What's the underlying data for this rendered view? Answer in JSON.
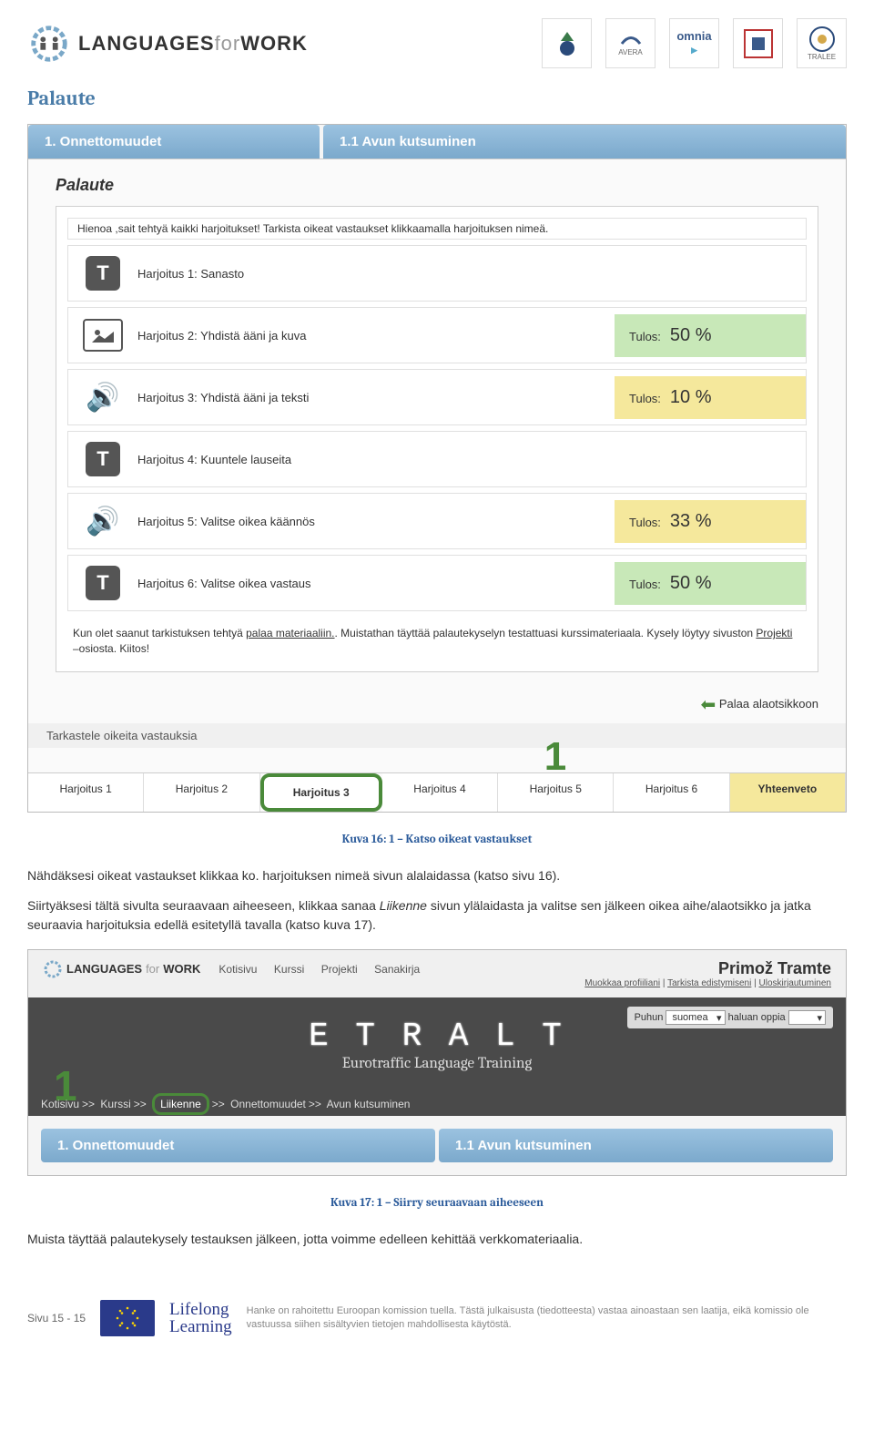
{
  "logo": {
    "text1": "LANGUAGES",
    "text2": "for",
    "text3": "WORK"
  },
  "partners": [
    "",
    "AVERA",
    "omnia",
    "",
    "TRALEE"
  ],
  "section_title": "Palaute",
  "tabs": {
    "tab1": "1. Onnettomuudet",
    "tab2": "1.1 Avun kutsuminen"
  },
  "palute_heading": "Palaute",
  "intro": "Hienoa ,sait tehtyä kaikki harjoitukset! Tarkista oikeat vastaukset klikkaamalla harjoituksen nimeä.",
  "exercises": [
    {
      "label": "Harjoitus 1: Sanasto",
      "tulos": "",
      "pct": "",
      "bg": ""
    },
    {
      "label": "Harjoitus 2: Yhdistä ääni ja kuva",
      "tulos": "Tulos:",
      "pct": "50 %",
      "bg": "bg-green"
    },
    {
      "label": "Harjoitus 3: Yhdistä ääni ja teksti",
      "tulos": "Tulos:",
      "pct": "10 %",
      "bg": "bg-yellow"
    },
    {
      "label": "Harjoitus 4: Kuuntele lauseita",
      "tulos": "",
      "pct": "",
      "bg": ""
    },
    {
      "label": "Harjoitus 5: Valitse oikea käännös",
      "tulos": "Tulos:",
      "pct": "33 %",
      "bg": "bg-yellow"
    },
    {
      "label": "Harjoitus 6: Valitse oikea vastaus",
      "tulos": "Tulos:",
      "pct": "50 %",
      "bg": "bg-green"
    }
  ],
  "note1": "Kun olet saanut tarkistuksen tehtyä ",
  "note_link1": "palaa materiaaliin.",
  "note2": ". Muistathan täyttää palautekyselyn testattuasi kurssimateriaala. Kysely löytyy sivuston ",
  "note_link2": "Projekti",
  "note3": " –osiosta. Kiitos!",
  "back_label": "Palaa alaotsikkoon",
  "review_label": "Tarkastele oikeita vastauksia",
  "marker1": "1",
  "tabs2": [
    "Harjoitus 1",
    "Harjoitus 2",
    "Harjoitus 3",
    "Harjoitus 4",
    "Harjoitus 5",
    "Harjoitus 6",
    "Yhteenveto"
  ],
  "caption1": "Kuva 16: 1 – Katso oikeat vastaukset",
  "para1a": "Nähdäksesi oikeat vastaukset klikkaa ko. harjoituksen nimeä sivun alalaidassa (katso sivu 16).",
  "para2a": "Siirtyäksesi tältä sivulta seuraavaan aiheeseen, klikkaa sanaa ",
  "para2em": "Liikenne",
  "para2b": " sivun ylälaidasta ja valitse sen jälkeen oikea aihe/alaotsikko ja jatka seuraavia harjoituksia edellä esitetyllä tavalla (katso kuva 17).",
  "menu": [
    "Kotisivu",
    "Kurssi",
    "Projekti",
    "Sanakirja"
  ],
  "user_name": "Primož Tramte",
  "user_links": [
    "Muokkaa profiiliani",
    "Tarkista edistymiseni",
    "Uloskirjautuminen"
  ],
  "lang": {
    "puhun": "Puhun",
    "suomea": "suomea",
    "haluan": "haluan oppia"
  },
  "hero_title": "E T R A L T",
  "hero_sub": "Eurotraffic Language Training",
  "breadcrumb": [
    "Kotisivu",
    "Kurssi",
    "Liikenne",
    "Onnettomuudet",
    "Avun kutsuminen"
  ],
  "caption2": "Kuva 17: 1 – Siirry seuraavaan aiheeseen",
  "para3": "Muista täyttää palautekysely testauksen jälkeen, jotta voimme edelleen kehittää verkkomateriaalia.",
  "footer": {
    "page": "Sivu 15 - 15",
    "lll1": "Lifelong",
    "lll2": "Learning",
    "note": "Hanke on rahoitettu Euroopan komission tuella. Tästä julkaisusta (tiedotteesta) vastaa ainoastaan sen laatija, eikä komissio ole vastuussa siihen sisältyvien tietojen mahdollisesta käytöstä."
  }
}
